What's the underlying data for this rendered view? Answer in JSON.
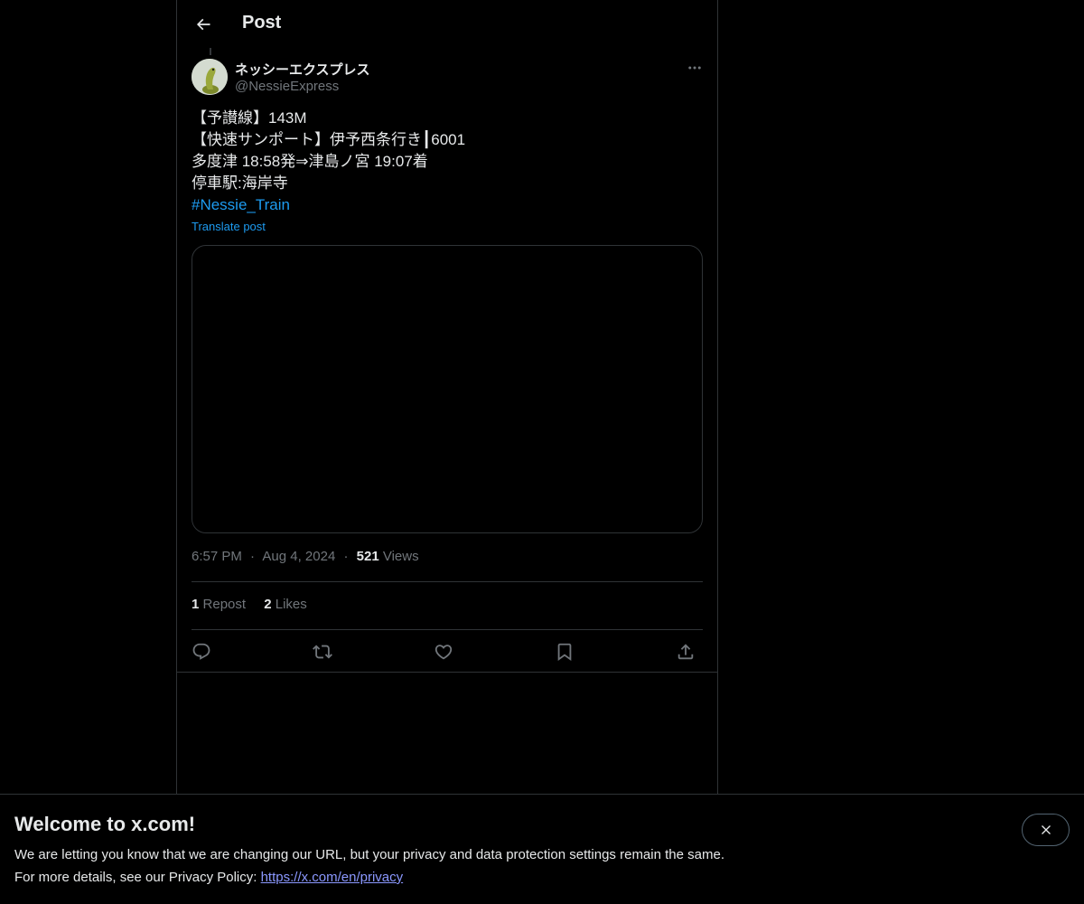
{
  "header": {
    "title": "Post",
    "back_icon": "arrow-left-icon"
  },
  "post": {
    "author": {
      "name": "ネッシーエクスプレス",
      "handle": "@NessieExpress"
    },
    "lines": [
      "【予讃線】143M",
      "【快速サンポート】伊予西条行き┃6001",
      "多度津 18:58発⇒津島ノ宮 19:07着",
      "停車駅:海岸寺"
    ],
    "hashtag": "#Nessie_Train",
    "translate_label": "Translate post",
    "time": "6:57 PM",
    "date": "Aug 4, 2024",
    "separator": "·",
    "views_count": "521",
    "views_label": "Views",
    "reposts_count": "1",
    "reposts_label": "Repost",
    "likes_count": "2",
    "likes_label": "Likes"
  },
  "banner": {
    "title": "Welcome to x.com!",
    "line1": "We are letting you know that we are changing our URL, but your privacy and data protection settings remain the same.",
    "line2_prefix": "For more details, see our Privacy Policy: ",
    "link": "https://x.com/en/privacy"
  },
  "colors": {
    "accent": "#1d9bf0",
    "text": "#e7e9ea",
    "muted": "#71767b",
    "border": "#2f3336",
    "link": "#8b98ff"
  }
}
